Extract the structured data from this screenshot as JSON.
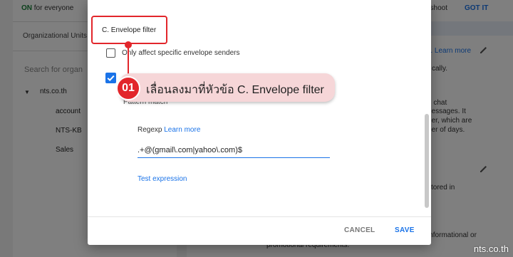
{
  "background": {
    "status_on": "ON",
    "status_rest": " for everyone",
    "org_units_label": "Organizational Units",
    "search_placeholder": "Search for organ",
    "tree_root": "nts.co.th",
    "tree_children": [
      "account",
      "NTS-KB",
      "Sales"
    ],
    "troubleshoot_fragment": "eshoot",
    "got_it": "GOT IT",
    "learn_more_fragment": "rs. Learn more",
    "right_lines": [
      "cally.",
      "d chat",
      "nessages. It",
      "der, which are",
      "ber of days.",
      "stored in",
      "informational or",
      "promotional requirements."
    ],
    "arrow_icon": "tree-expand-arrow-icon",
    "pencil_icon": "pencil-edit-icon"
  },
  "dialog": {
    "section_title": "C. Envelope filter",
    "only_affect_label": "Only affect specific envelope senders",
    "pattern_match_label": "Pattern match",
    "regexp_label": "Regexp",
    "regexp_learn_more": "Learn more",
    "regexp_value": ".+@(gmail\\.com|yahoo\\.com)$",
    "test_expression": "Test expression",
    "cancel_label": "CANCEL",
    "save_label": "SAVE",
    "accent_color": "#1a73e8"
  },
  "annotation": {
    "step_number": "01",
    "instruction": "เลื่อนลงมาที่หัวข้อ C. Envelope filter",
    "accent_color": "#e2262b"
  },
  "watermark": "nts.co.th"
}
